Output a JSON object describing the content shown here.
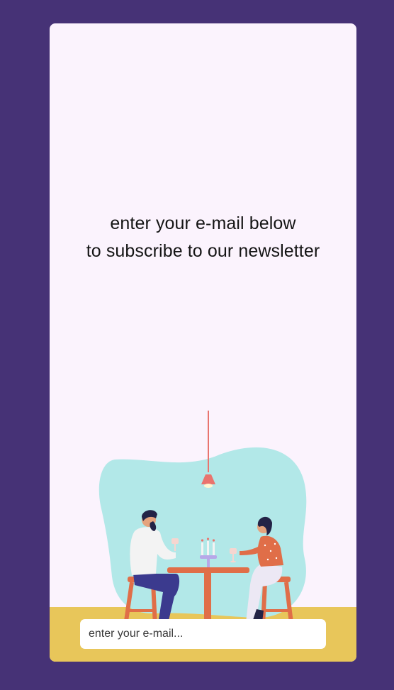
{
  "page": {
    "background_color": "#463276",
    "card_color": "#fbf3fd",
    "floor_color": "#e8c65a"
  },
  "headline": {
    "line1": "enter your e-mail below",
    "line2": "to subscribe to our newsletter"
  },
  "email": {
    "placeholder": "enter your e-mail...",
    "value": ""
  },
  "illustration": {
    "name": "couple-dining-illustration",
    "blob_color": "#b2e8e8",
    "table_color": "#e06e48",
    "lamp_color": "#e9746e"
  }
}
